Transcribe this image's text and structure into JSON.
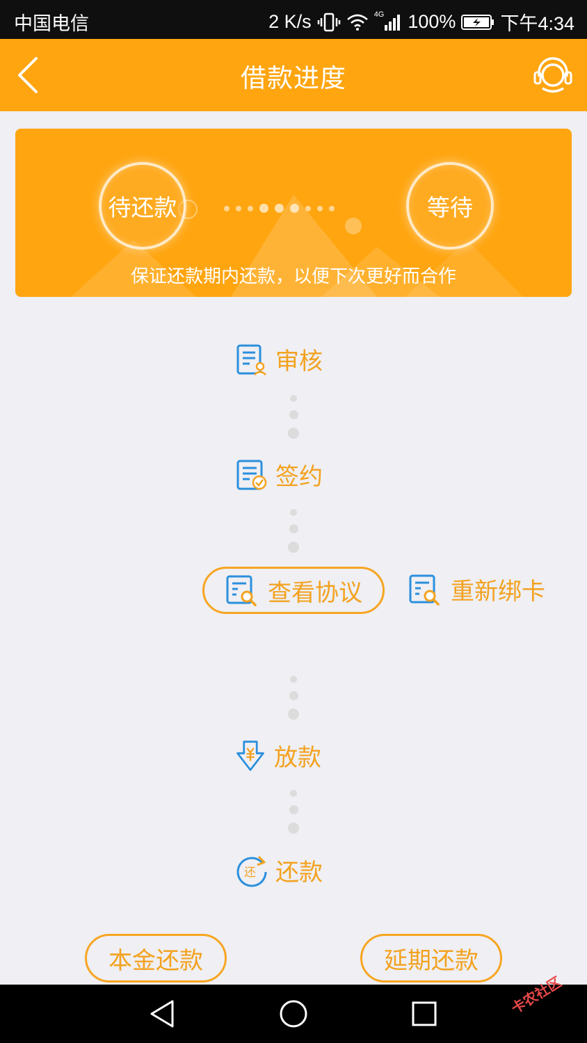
{
  "status_bar": {
    "carrier": "中国电信",
    "speed": "2 K/s",
    "network": "4G",
    "battery": "100%",
    "time": "下午4:34"
  },
  "header": {
    "title": "借款进度",
    "back_icon": "chevron-left-icon",
    "support_icon": "headset-icon"
  },
  "banner": {
    "current_stage": "待还款",
    "next_stage": "等待",
    "caption": "保证还款期内还款，以便下次更好而合作"
  },
  "steps": {
    "review": "审核",
    "sign": "签约",
    "view_agreement": "查看协议",
    "rebind_card": "重新绑卡",
    "disburse": "放款",
    "repay": "还款"
  },
  "actions": {
    "principal_repay": "本金还款",
    "extend_repay": "延期还款"
  },
  "watermark": "卡农社区",
  "colors": {
    "accent": "#ffa510",
    "step_text": "#f3a21f",
    "icon_blue": "#2b8fdc"
  }
}
